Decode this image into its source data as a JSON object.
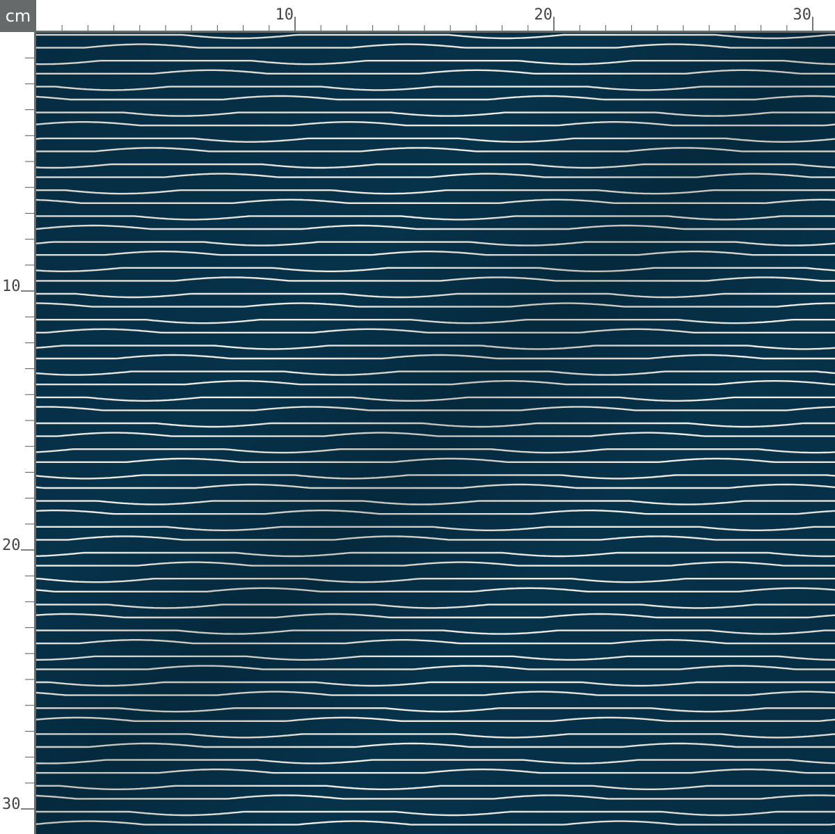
{
  "rulers": {
    "unit": "cm",
    "top_labels": [
      "10",
      "20",
      "30"
    ],
    "left_labels": [
      "10",
      "20",
      "30"
    ]
  },
  "swatch": {
    "background_color": "#06324a",
    "line_color": "#efece4",
    "pattern": "wavy horizontal lines"
  }
}
